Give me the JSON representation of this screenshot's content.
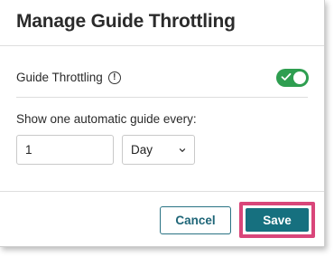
{
  "dialog": {
    "title": "Manage Guide Throttling"
  },
  "throttling": {
    "label": "Guide Throttling",
    "info_icon": "info-circle-icon",
    "info_glyph": "!",
    "enabled": true,
    "toggle_color": "#2e9e50"
  },
  "frequency": {
    "label": "Show one automatic guide every:",
    "count_value": "1",
    "unit_selected": "Day"
  },
  "footer": {
    "cancel_label": "Cancel",
    "save_label": "Save",
    "highlight_color": "#d9467a",
    "save_color": "#16707f"
  }
}
